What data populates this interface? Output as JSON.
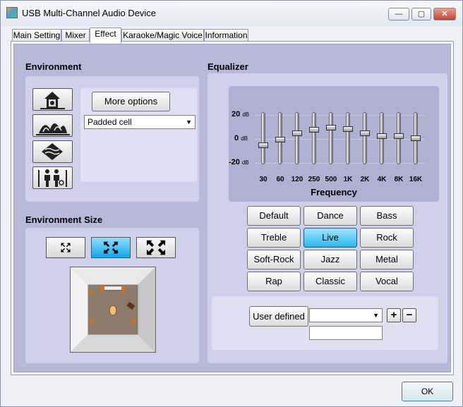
{
  "window": {
    "title": "USB Multi-Channel Audio Device"
  },
  "titlebar_buttons": {
    "minimize": "—",
    "maximize": "▢",
    "close": "✕"
  },
  "tabs": [
    {
      "label": "Main Setting",
      "active": false
    },
    {
      "label": "Mixer",
      "active": false
    },
    {
      "label": "Effect",
      "active": true
    },
    {
      "label": "Karaoke/Magic Voice",
      "active": false
    },
    {
      "label": "Information",
      "active": false
    }
  ],
  "environment": {
    "title": "Environment",
    "more_options": "More options",
    "selected": "Padded cell",
    "icons": [
      "house-icon",
      "opera-house-icon",
      "water-icon",
      "people-icon"
    ]
  },
  "environment_size": {
    "title": "Environment Size",
    "selected_index": 1
  },
  "equalizer": {
    "title": "Equalizer",
    "db_labels": {
      "top": "20",
      "mid": "0",
      "bottom": "-20",
      "unit": "dB"
    },
    "frequencies": [
      "30",
      "60",
      "120",
      "250",
      "500",
      "1K",
      "2K",
      "4K",
      "8K",
      "16K"
    ],
    "levels_db": [
      -6,
      -1,
      4,
      7,
      9,
      8,
      4,
      2,
      2,
      0
    ],
    "frequency_label": "Frequency",
    "presets": [
      "Default",
      "Dance",
      "Bass",
      "Treble",
      "Live",
      "Rock",
      "Soft-Rock",
      "Jazz",
      "Metal",
      "Rap",
      "Classic",
      "Vocal"
    ],
    "active_preset": "Live",
    "user_defined": "User defined",
    "user_defined_value": "",
    "add": "+",
    "remove": "−"
  },
  "footer": {
    "ok": "OK"
  },
  "colors": {
    "accent": "#2ab8f0",
    "panel": "#b6b9d8"
  }
}
